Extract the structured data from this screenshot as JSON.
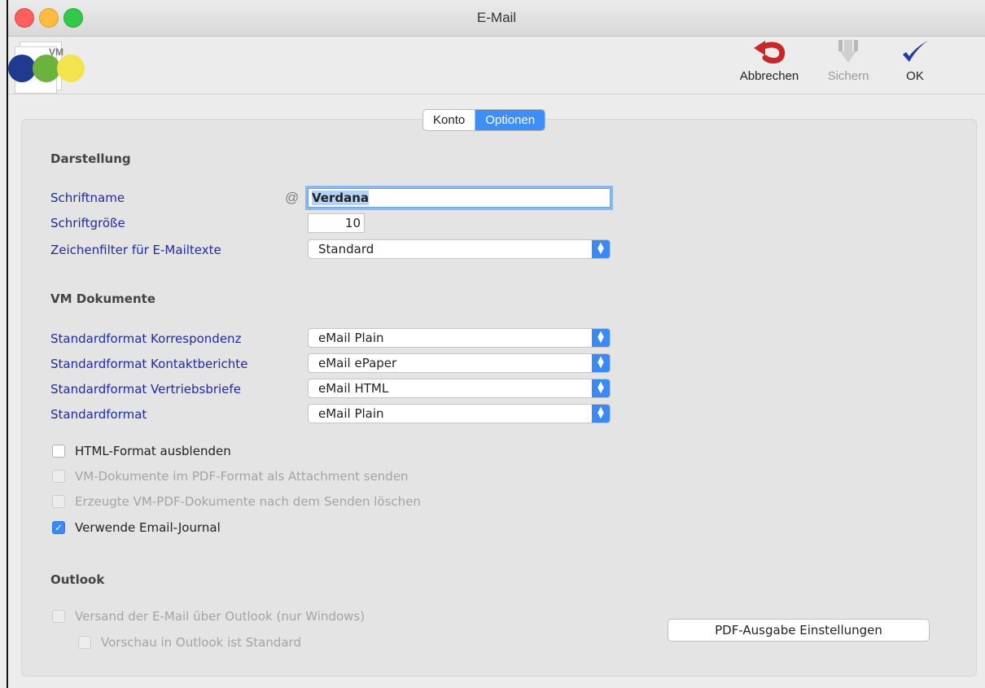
{
  "window": {
    "title": "E-Mail"
  },
  "logo": {
    "text": "VM"
  },
  "toolbar": {
    "cancel_label": "Abbrechen",
    "save_label": "Sichern",
    "ok_label": "OK"
  },
  "tabs": [
    {
      "label": "Konto",
      "active": false
    },
    {
      "label": "Optionen",
      "active": true
    }
  ],
  "darstellung": {
    "heading": "Darstellung",
    "font_name_label": "Schriftname",
    "font_name_value": "Verdana",
    "font_size_label": "Schriftgröße",
    "font_size_value": "10",
    "filter_label": "Zeichenfilter für E-Mailtexte",
    "filter_value": "Standard"
  },
  "vm_dokumente": {
    "heading": "VM Dokumente",
    "rows": [
      {
        "label": "Standardformat Korrespondenz",
        "value": "eMail Plain"
      },
      {
        "label": "Standardformat Kontaktberichte",
        "value": "eMail ePaper"
      },
      {
        "label": "Standardformat Vertriebsbriefe",
        "value": "eMail HTML"
      },
      {
        "label": "Standardformat",
        "value": "eMail Plain"
      }
    ]
  },
  "checkboxes": [
    {
      "label": "HTML-Format ausblenden",
      "checked": false,
      "enabled": true
    },
    {
      "label": "VM-Dokumente im PDF-Format als Attachment senden",
      "checked": false,
      "enabled": false
    },
    {
      "label": "Erzeugte VM-PDF-Dokumente nach dem Senden löschen",
      "checked": false,
      "enabled": false
    },
    {
      "label": "Verwende Email-Journal",
      "checked": true,
      "enabled": true
    }
  ],
  "outlook": {
    "heading": "Outlook",
    "send_via_outlook_label": "Versand der E-Mail über Outlook (nur Windows)",
    "preview_label": "Vorschau in Outlook ist Standard",
    "pdf_button_label": "PDF-Ausgabe Einstellungen"
  },
  "colors": {
    "accent": "#3b8af4",
    "label_blue": "#1e2aa8",
    "cancel_icon": "#c8272a",
    "ok_icon": "#1f3d9c"
  }
}
